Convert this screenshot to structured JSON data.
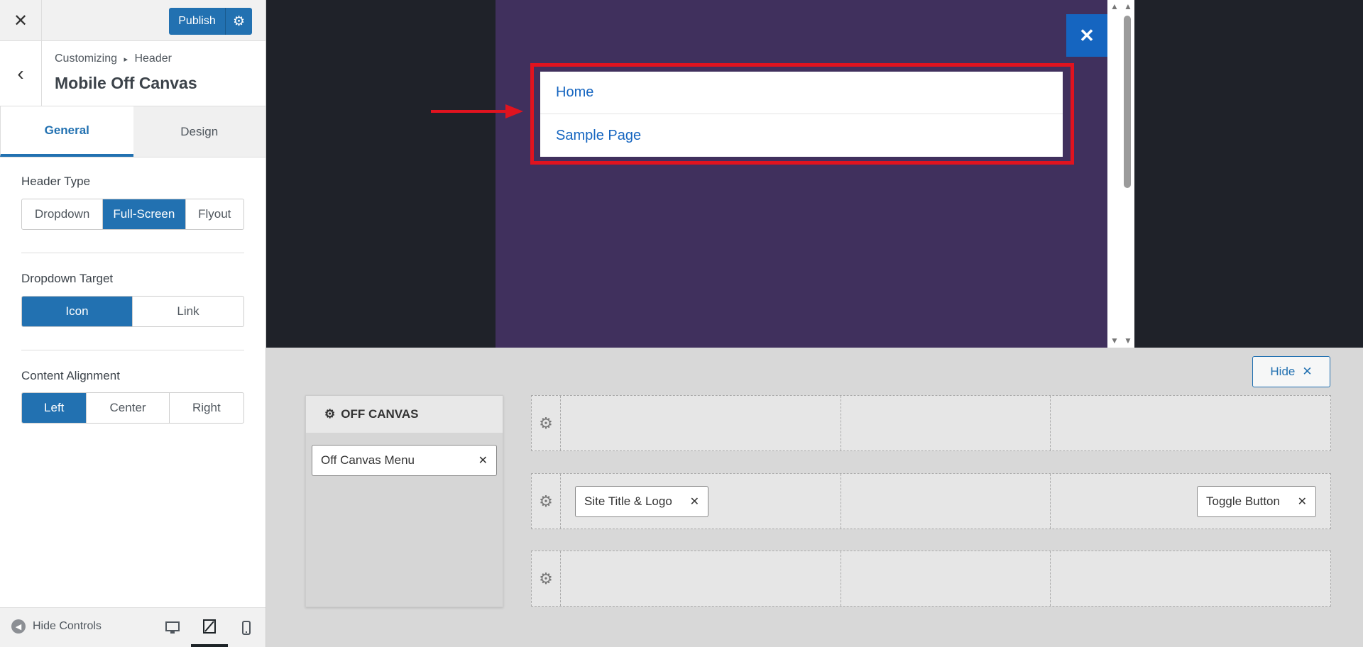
{
  "topbar": {
    "close_icon": "close-icon",
    "publish_label": "Publish",
    "settings_icon": "gear-icon"
  },
  "section": {
    "breadcrumb_root": "Customizing",
    "breadcrumb_sep": "▸",
    "breadcrumb_parent": "Header",
    "title": "Mobile Off Canvas"
  },
  "tabs": [
    {
      "label": "General",
      "active": true
    },
    {
      "label": "Design",
      "active": false
    }
  ],
  "controls": {
    "header_type": {
      "label": "Header Type",
      "options": [
        "Dropdown",
        "Full-Screen",
        "Flyout"
      ],
      "selected": "Full-Screen"
    },
    "dropdown_target": {
      "label": "Dropdown Target",
      "options": [
        "Icon",
        "Link"
      ],
      "selected": "Icon"
    },
    "content_alignment": {
      "label": "Content Alignment",
      "options": [
        "Left",
        "Center",
        "Right"
      ],
      "selected": "Left"
    }
  },
  "footer": {
    "hide_controls": "Hide Controls",
    "devices": [
      "desktop",
      "tablet",
      "mobile"
    ],
    "active_device": "tablet"
  },
  "preview": {
    "menu_items": [
      "Home",
      "Sample Page"
    ],
    "close_icon": "close-icon"
  },
  "builder": {
    "hide_label": "Hide",
    "off_canvas_title": "OFF CANVAS",
    "off_canvas_items": [
      "Off Canvas Menu"
    ],
    "row2_left": "Site Title & Logo",
    "row2_right": "Toggle Button"
  },
  "colors": {
    "accent": "#2271b1",
    "preview_bg": "#40305d",
    "highlight": "#e0131f"
  }
}
